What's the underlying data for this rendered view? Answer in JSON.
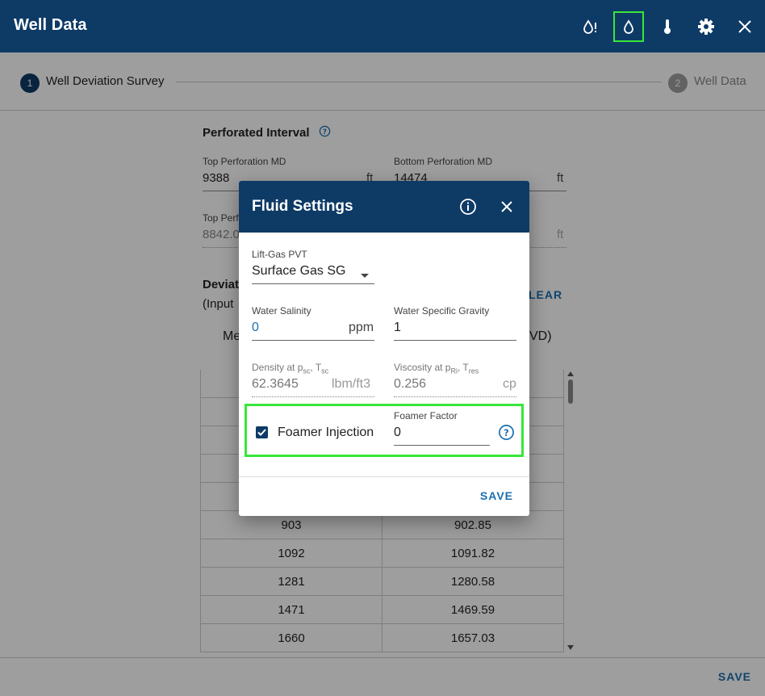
{
  "window": {
    "title": "Well Data",
    "icons": [
      "oil-drop-alert-icon",
      "water-drop-icon",
      "thermometer-icon",
      "gear-icon",
      "close-icon"
    ]
  },
  "stepper": {
    "steps": [
      {
        "number": "1",
        "label": "Well Deviation Survey",
        "active": true
      },
      {
        "number": "2",
        "label": "Well Data",
        "active": false
      }
    ]
  },
  "perforated": {
    "title": "Perforated Interval",
    "top_md_label": "Top Perforation MD",
    "top_md_value": "9388",
    "top_md_unit": "ft",
    "bottom_md_label": "Bottom Perforation MD",
    "bottom_md_value": "14474",
    "bottom_md_unit": "ft",
    "top_tvd_label_partial": "Top Perf",
    "top_tvd_value_partial": "8842.0",
    "bottom_tvd_unit": "ft"
  },
  "deviation": {
    "title_partial": "Deviat",
    "subtitle_partial": "(Input",
    "clear_partial": "LEAR",
    "col1_header_partial": "Me",
    "col2_header_partial": "VD)",
    "rows": [
      [
        "903",
        "902.85"
      ],
      [
        "1092",
        "1091.82"
      ],
      [
        "1281",
        "1280.58"
      ],
      [
        "1471",
        "1469.59"
      ],
      [
        "1660",
        "1657.03"
      ]
    ]
  },
  "footer": {
    "save_label": "SAVE"
  },
  "dialog": {
    "title": "Fluid Settings",
    "lift_gas_label": "Lift-Gas PVT",
    "lift_gas_value": "Surface Gas SG",
    "water_salinity_label": "Water Salinity",
    "water_salinity_value": "0",
    "water_salinity_unit": "ppm",
    "water_sg_label": "Water Specific Gravity",
    "water_sg_value": "1",
    "density_label": "Density at p",
    "density_label_sub1": "sc",
    "density_label_mid": ", T",
    "density_label_sub2": "sc",
    "density_value": "62.3645",
    "density_unit": "lbm/ft3",
    "viscosity_label": "Viscosity at p",
    "viscosity_label_sub1": "Ri",
    "viscosity_label_mid": ", T",
    "viscosity_label_sub2": "res",
    "viscosity_value": "0.256",
    "viscosity_unit": "cp",
    "foamer_injection_label": "Foamer Injection",
    "foamer_injection_checked": true,
    "foamer_factor_label": "Foamer Factor",
    "foamer_factor_value": "0",
    "save_label": "SAVE"
  },
  "colors": {
    "header_bg": "#0e3a66",
    "accent": "#1a6fb0",
    "highlight": "#39e639"
  }
}
